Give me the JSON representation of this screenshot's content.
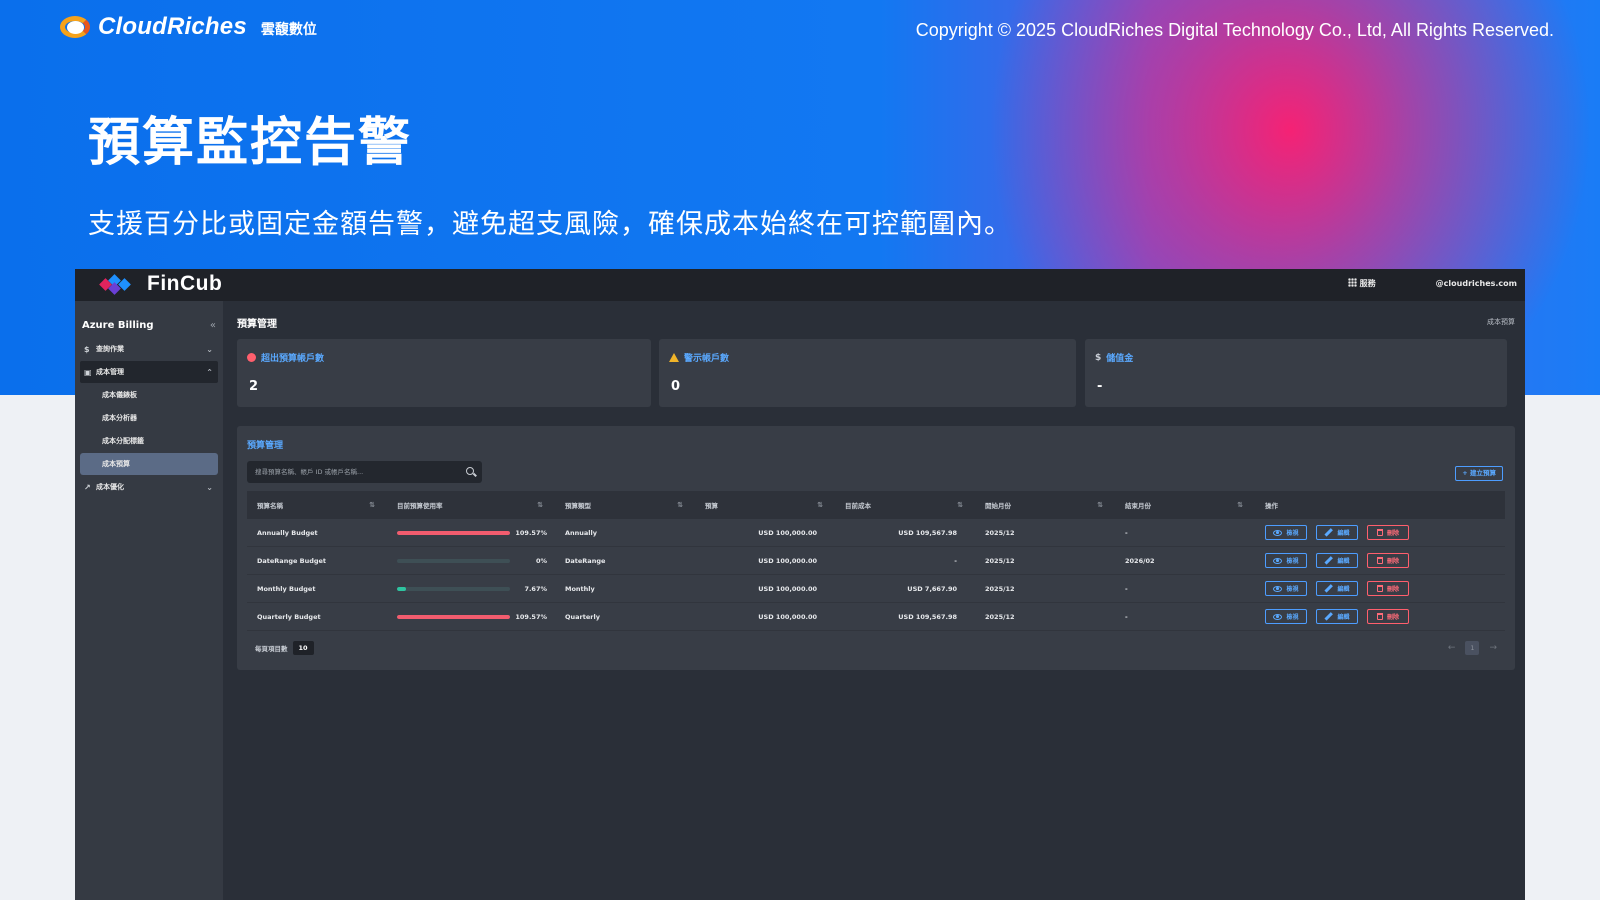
{
  "slide": {
    "brand": "CloudRiches",
    "brand_sub": "雲馥數位",
    "copyright": "Copyright © 2025 CloudRiches Digital Technology Co., Ltd, All Rights Reserved.",
    "title": "預算監控告警",
    "subtitle": "支援百分比或固定金額告警，避免超支風險，確保成本始終在可控範圍內。"
  },
  "app": {
    "brand": "FinCub",
    "services_label": "服務",
    "user_email": "@cloudriches.com"
  },
  "sidebar": {
    "title": "Azure Billing",
    "collapse_icon": "double-chevron-left-icon",
    "items": [
      {
        "label": "查詢作業",
        "icon": "dollar-icon"
      },
      {
        "label": "成本管理",
        "icon": "chart-icon"
      },
      {
        "label": "成本優化",
        "icon": "trend-icon"
      }
    ],
    "subitems": [
      {
        "label": "成本儀錶板"
      },
      {
        "label": "成本分析器"
      },
      {
        "label": "成本分配標籤"
      },
      {
        "label": "成本預算"
      }
    ]
  },
  "page": {
    "title": "預算管理",
    "breadcrumb": "成本預算"
  },
  "cards": [
    {
      "label": "超出預算帳戶數",
      "value": "2",
      "icon": "error-icon",
      "color": "#ff5f6d"
    },
    {
      "label": "警示帳戶數",
      "value": "0",
      "icon": "warning-icon",
      "color": "#f0b429"
    },
    {
      "label": "儲值金",
      "value": "-",
      "icon": "dollar-icon"
    }
  ],
  "panel": {
    "title": "預算管理",
    "search_placeholder": "搜尋預算名稱、帳戶 ID 或帳戶名稱...",
    "create_label": "+ 建立預算",
    "page_size_label": "每頁項目數",
    "page_size": "10",
    "current_page": "1"
  },
  "table": {
    "headers": [
      "預算名稱",
      "目前預算使用率",
      "預算類型",
      "預算",
      "目前成本",
      "開始月份",
      "結束月份",
      "操作"
    ],
    "actions": {
      "view": "檢視",
      "edit": "編輯",
      "delete": "刪除"
    },
    "rows": [
      {
        "name": "Annually Budget",
        "usage_pct": 109.57,
        "usage_text": "109.57%",
        "type": "Annually",
        "budget": "USD 100,000.00",
        "cost": "USD 109,567.98",
        "start": "2025/12",
        "end": "-"
      },
      {
        "name": "DateRange Budget",
        "usage_pct": 0,
        "usage_text": "0%",
        "type": "DateRange",
        "budget": "USD 100,000.00",
        "cost": "-",
        "start": "2025/12",
        "end": "2026/02"
      },
      {
        "name": "Monthly Budget",
        "usage_pct": 7.67,
        "usage_text": "7.67%",
        "type": "Monthly",
        "budget": "USD 100,000.00",
        "cost": "USD 7,667.90",
        "start": "2025/12",
        "end": "-"
      },
      {
        "name": "Quarterly Budget",
        "usage_pct": 109.57,
        "usage_text": "109.57%",
        "type": "Quarterly",
        "budget": "USD 100,000.00",
        "cost": "USD 109,567.98",
        "start": "2025/12",
        "end": "-"
      }
    ]
  },
  "colors": {
    "over_budget": "#f25c6e",
    "under_budget": "#2ec4a0",
    "accent": "#5aa9ff"
  }
}
